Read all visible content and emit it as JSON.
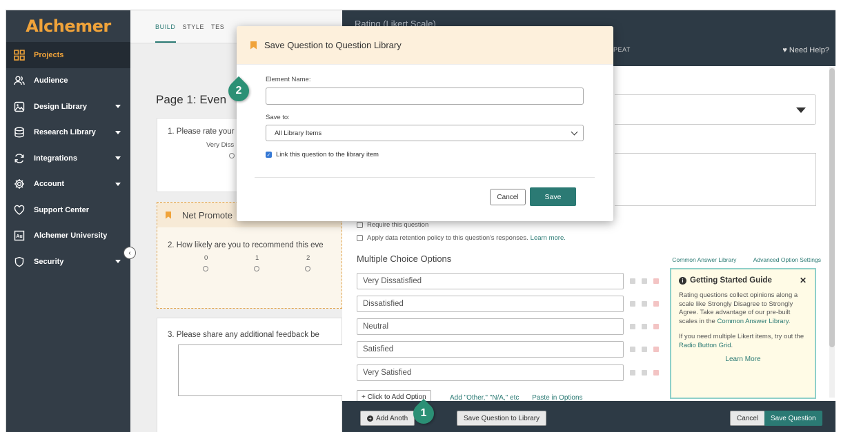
{
  "sidebar": {
    "logo": "Alchemer",
    "items": [
      {
        "label": "Projects",
        "icon": "grid-icon",
        "active": true,
        "caret": false
      },
      {
        "label": "Audience",
        "icon": "people-icon",
        "active": false,
        "caret": false
      },
      {
        "label": "Design Library",
        "icon": "image-icon",
        "active": false,
        "caret": true
      },
      {
        "label": "Research Library",
        "icon": "database-icon",
        "active": false,
        "caret": true
      },
      {
        "label": "Integrations",
        "icon": "sync-icon",
        "active": false,
        "caret": true
      },
      {
        "label": "Account",
        "icon": "gear-icon",
        "active": false,
        "caret": true
      },
      {
        "label": "Support Center",
        "icon": "heart-icon",
        "active": false,
        "caret": false
      },
      {
        "label": "Alchemer University",
        "icon": "au-icon",
        "active": false,
        "caret": false
      },
      {
        "label": "Security",
        "icon": "shield-icon",
        "active": false,
        "caret": true
      }
    ]
  },
  "builder": {
    "tabs": [
      "BUILD",
      "STYLE",
      "TES"
    ],
    "page_title": "Page 1: Even",
    "q1": {
      "text": "1. Please rate your",
      "scale_label": "Very Diss"
    },
    "q2": {
      "header": "Net Promote",
      "text": "2. How likely are you to recommend this eve",
      "scale": [
        "0",
        "1",
        "2"
      ]
    },
    "q3": {
      "text": "3. Please share any additional feedback be"
    }
  },
  "editor": {
    "title": "Rating (Likert Scale)",
    "repeat_tab": "PEAT",
    "help": "Need Help?",
    "require_label": "Require this question",
    "retention_label": "Apply data retention policy to this question's responses.",
    "retention_link": "Learn more.",
    "mc_title": "Multiple Choice Options",
    "mc_links": [
      "Common Answer Library",
      "Advanced Option Settings"
    ],
    "options": [
      "Very Dissatisfied",
      "Dissatisfied",
      "Neutral",
      "Satisfied",
      "Very Satisfied"
    ],
    "add_option": "+ Click to Add Option",
    "add_links": [
      "Add \"Other,\" \"N/A,\" etc",
      "Paste in Options"
    ],
    "guide": {
      "title": "Getting Started Guide",
      "p1_text": "Rating questions collect opinions along a scale like Strongly Disagree to Strongly Agree. Take advantage of our pre-built scales in the ",
      "p1_link": "Common Answer Library",
      "p1_end": ".",
      "p2_text": "If you need multiple Likert items, try out the ",
      "p2_link": "Radio Button Grid",
      "p2_end": ".",
      "learn_more": "Learn More"
    },
    "footer": {
      "add_another": "Add Anoth",
      "save_to_library": "Save Question to Library",
      "cancel": "Cancel",
      "save_question": "Save Question"
    }
  },
  "modal": {
    "title": "Save Question to Question Library",
    "element_name_label": "Element Name:",
    "element_name_value": "",
    "save_to_label": "Save to:",
    "save_to_value": "All Library Items",
    "link_label": "Link this question to the library item",
    "link_checked": true,
    "cancel": "Cancel",
    "save": "Save"
  },
  "steps": [
    "1",
    "2"
  ],
  "colors": {
    "accent": "#2b7a74",
    "brand": "#f0a33a",
    "sidebar": "#333d47",
    "step": "#2b9075"
  }
}
